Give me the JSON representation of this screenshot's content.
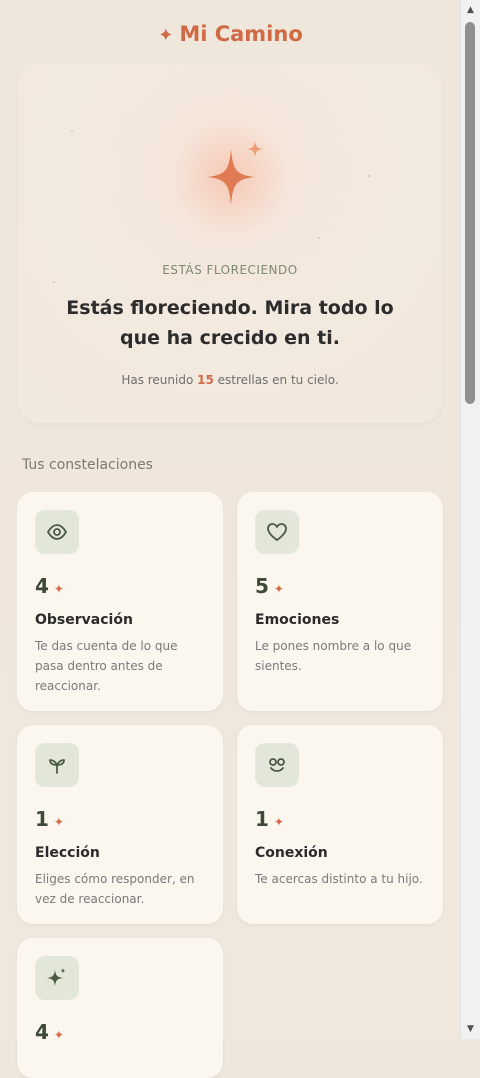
{
  "header": {
    "title": "Mi Camino"
  },
  "hero": {
    "eyebrow": "ESTÁS FLORECIENDO",
    "title": "Estás floreciendo. Mira todo lo que ha crecido en ti.",
    "subtitle_prefix": "Has reunido",
    "stars": "15",
    "subtitle_suffix": "estrellas en tu cielo."
  },
  "section": {
    "title": "Tus constelaciones"
  },
  "cards": [
    {
      "count": "4",
      "title": "Observación",
      "description": "Te das cuenta de lo que pasa dentro antes de reaccionar.",
      "icon": "eye-icon"
    },
    {
      "count": "5",
      "title": "Emociones",
      "description": "Le pones nombre a lo que sientes.",
      "icon": "heart-icon"
    },
    {
      "count": "1",
      "title": "Elección",
      "description": "Eliges cómo responder, en vez de reaccionar.",
      "icon": "sprout-icon"
    },
    {
      "count": "1",
      "title": "Conexión",
      "description": "Te acercas distinto a tu hijo.",
      "icon": "connection-icon"
    },
    {
      "count": "4",
      "title": "",
      "description": "",
      "icon": "sparkle-icon"
    }
  ],
  "colors": {
    "accent": "#cf6a44",
    "sage": "#3f4a36",
    "card": "#fbf6ee"
  }
}
